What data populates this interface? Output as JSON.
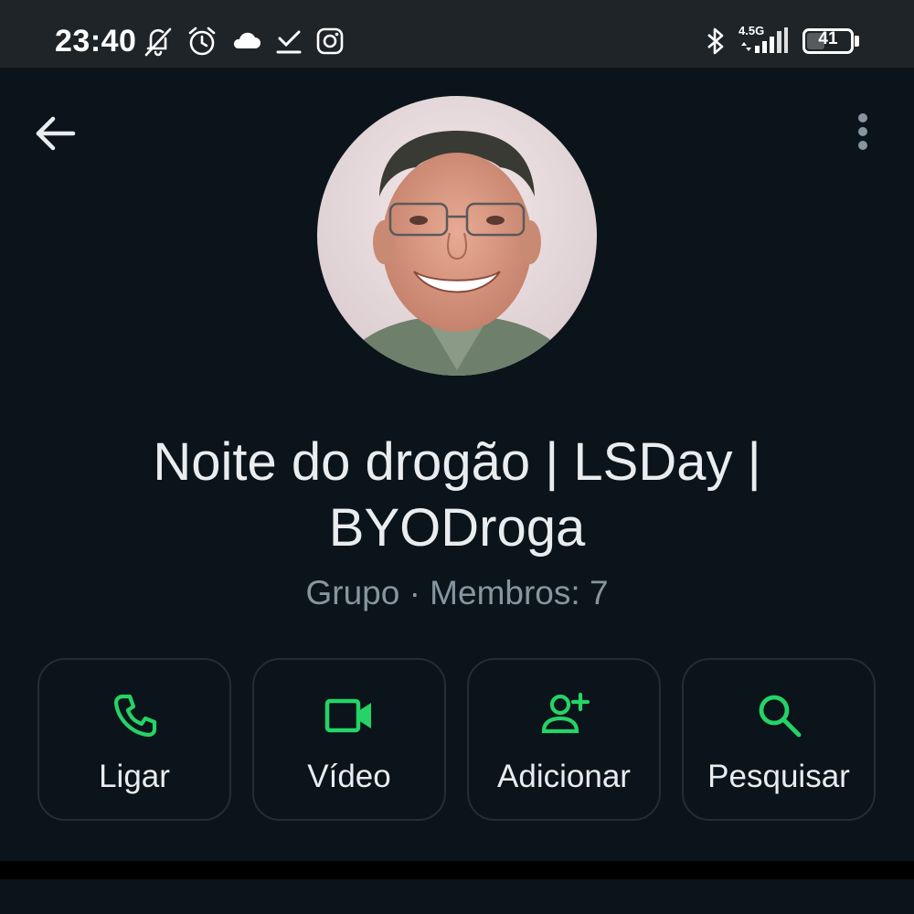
{
  "status_bar": {
    "time": "23:40",
    "network": "4.5G",
    "battery": "41",
    "battery_level": 0.41,
    "icons": [
      "vibrate-off-icon",
      "alarm-icon",
      "cloud-icon",
      "download-done-icon",
      "instagram-icon",
      "bluetooth-icon",
      "signal-icon",
      "battery-icon"
    ]
  },
  "header": {
    "back_icon": "arrow-left-icon",
    "menu_icon": "more-vertical-icon"
  },
  "group": {
    "name": "Noite do drogão | LSDay | BYODroga",
    "subtitle": "Grupo · Membros: 7"
  },
  "actions": [
    {
      "label": "Ligar",
      "icon": "phone-icon"
    },
    {
      "label": "Vídeo",
      "icon": "videocam-icon"
    },
    {
      "label": "Adicionar",
      "icon": "add-person-icon"
    },
    {
      "label": "Pesquisar",
      "icon": "search-icon"
    }
  ],
  "colors": {
    "background": "#0b141a",
    "status_bar": "#1f2429",
    "accent": "#25d366",
    "text_primary": "#e9edef",
    "text_secondary": "#8696a0",
    "button_border": "#262d31"
  }
}
